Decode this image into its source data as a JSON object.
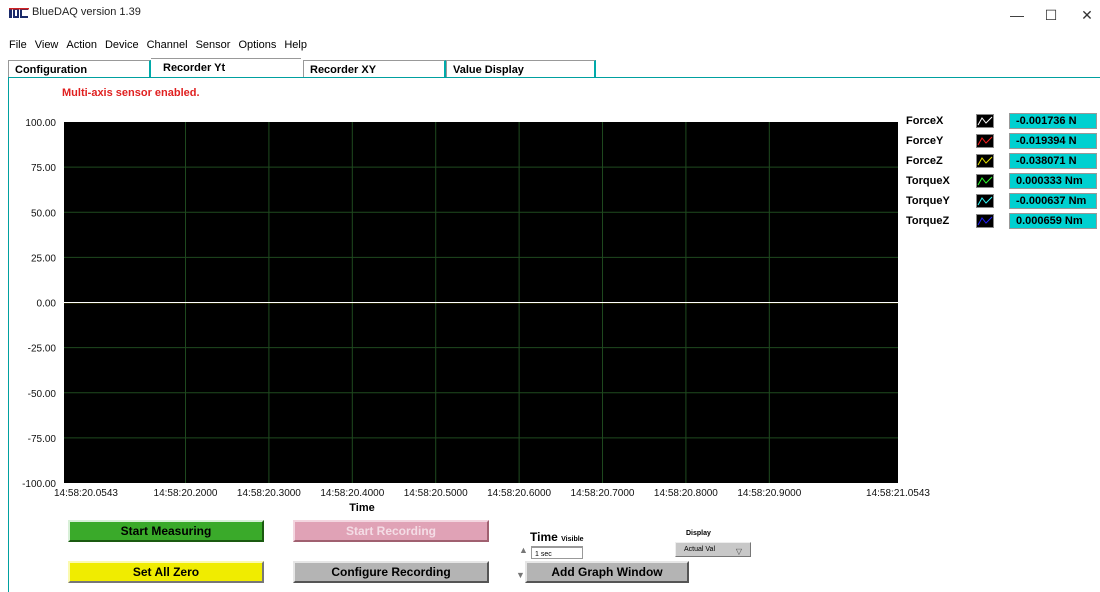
{
  "window": {
    "title": "BlueDAQ version 1.39",
    "logo_text": "IDC",
    "controls": {
      "minimize": "—",
      "maximize": "☐",
      "close": "✕"
    }
  },
  "menu": [
    "File",
    "View",
    "Action",
    "Device",
    "Channel",
    "Sensor",
    "Options",
    "Help"
  ],
  "tabs": [
    {
      "label": "Configuration",
      "active": false
    },
    {
      "label": "Recorder Yt",
      "active": true
    },
    {
      "label": "Recorder XY",
      "active": false
    },
    {
      "label": "Value Display",
      "active": false
    }
  ],
  "status_message": "Multi-axis sensor enabled.",
  "chart_data": {
    "type": "line",
    "xlabel": "Time",
    "ylabel": "",
    "ylim": [
      -100,
      100
    ],
    "yticks": [
      "100.00",
      "75.00",
      "50.00",
      "25.00",
      "0.00",
      "-25.00",
      "-50.00",
      "-75.00",
      "-100.00"
    ],
    "xticks": [
      "14:58:20.0543",
      "14:58:20.2000",
      "14:58:20.3000",
      "14:58:20.4000",
      "14:58:20.5000",
      "14:58:20.6000",
      "14:58:20.7000",
      "14:58:20.8000",
      "14:58:20.9000",
      "14:58:21.0543"
    ],
    "xlim": [
      "14:58:20.0543",
      "14:58:21.0543"
    ],
    "grid": true,
    "background": "#000000",
    "grid_color": "#1f4a1f",
    "series": [
      {
        "name": "ForceX",
        "value": -0.001736,
        "color": "#ffffff"
      },
      {
        "name": "ForceY",
        "value": -0.019394,
        "color": "#ff2020"
      },
      {
        "name": "ForceZ",
        "value": -0.038071,
        "color": "#e8e800"
      },
      {
        "name": "TorqueX",
        "value": 0.000333,
        "color": "#30ff30"
      },
      {
        "name": "TorqueY",
        "value": -0.000637,
        "color": "#30ffff"
      },
      {
        "name": "TorqueZ",
        "value": 0.000659,
        "color": "#2020ff"
      }
    ]
  },
  "legend": [
    {
      "name": "ForceX",
      "value": "-0.001736 N",
      "color": "#ffffff"
    },
    {
      "name": "ForceY",
      "value": "-0.019394 N",
      "color": "#ff2020"
    },
    {
      "name": "ForceZ",
      "value": "-0.038071 N",
      "color": "#e8e800"
    },
    {
      "name": "TorqueX",
      "value": "0.000333 Nm",
      "color": "#30ff30"
    },
    {
      "name": "TorqueY",
      "value": "-0.000637 Nm",
      "color": "#30ffff"
    },
    {
      "name": "TorqueZ",
      "value": "0.000659 Nm",
      "color": "#2020ff"
    }
  ],
  "buttons": {
    "start_measuring": "Start Measuring",
    "start_recording": "Start Recording",
    "set_all_zero": "Set All Zero",
    "configure_recording": "Configure Recording",
    "add_graph_window": "Add Graph Window"
  },
  "time_control": {
    "label": "Time",
    "sublabel": "Visible",
    "value": "1 sec"
  },
  "display_control": {
    "label": "Display",
    "value": "Actual Val"
  },
  "colors": {
    "accent": "#00a0a0",
    "status_red": "#e02020",
    "value_bg": "#00d0d0",
    "start_measuring_bg": "#3aaa2a",
    "set_zero_bg": "#f0ec00"
  }
}
